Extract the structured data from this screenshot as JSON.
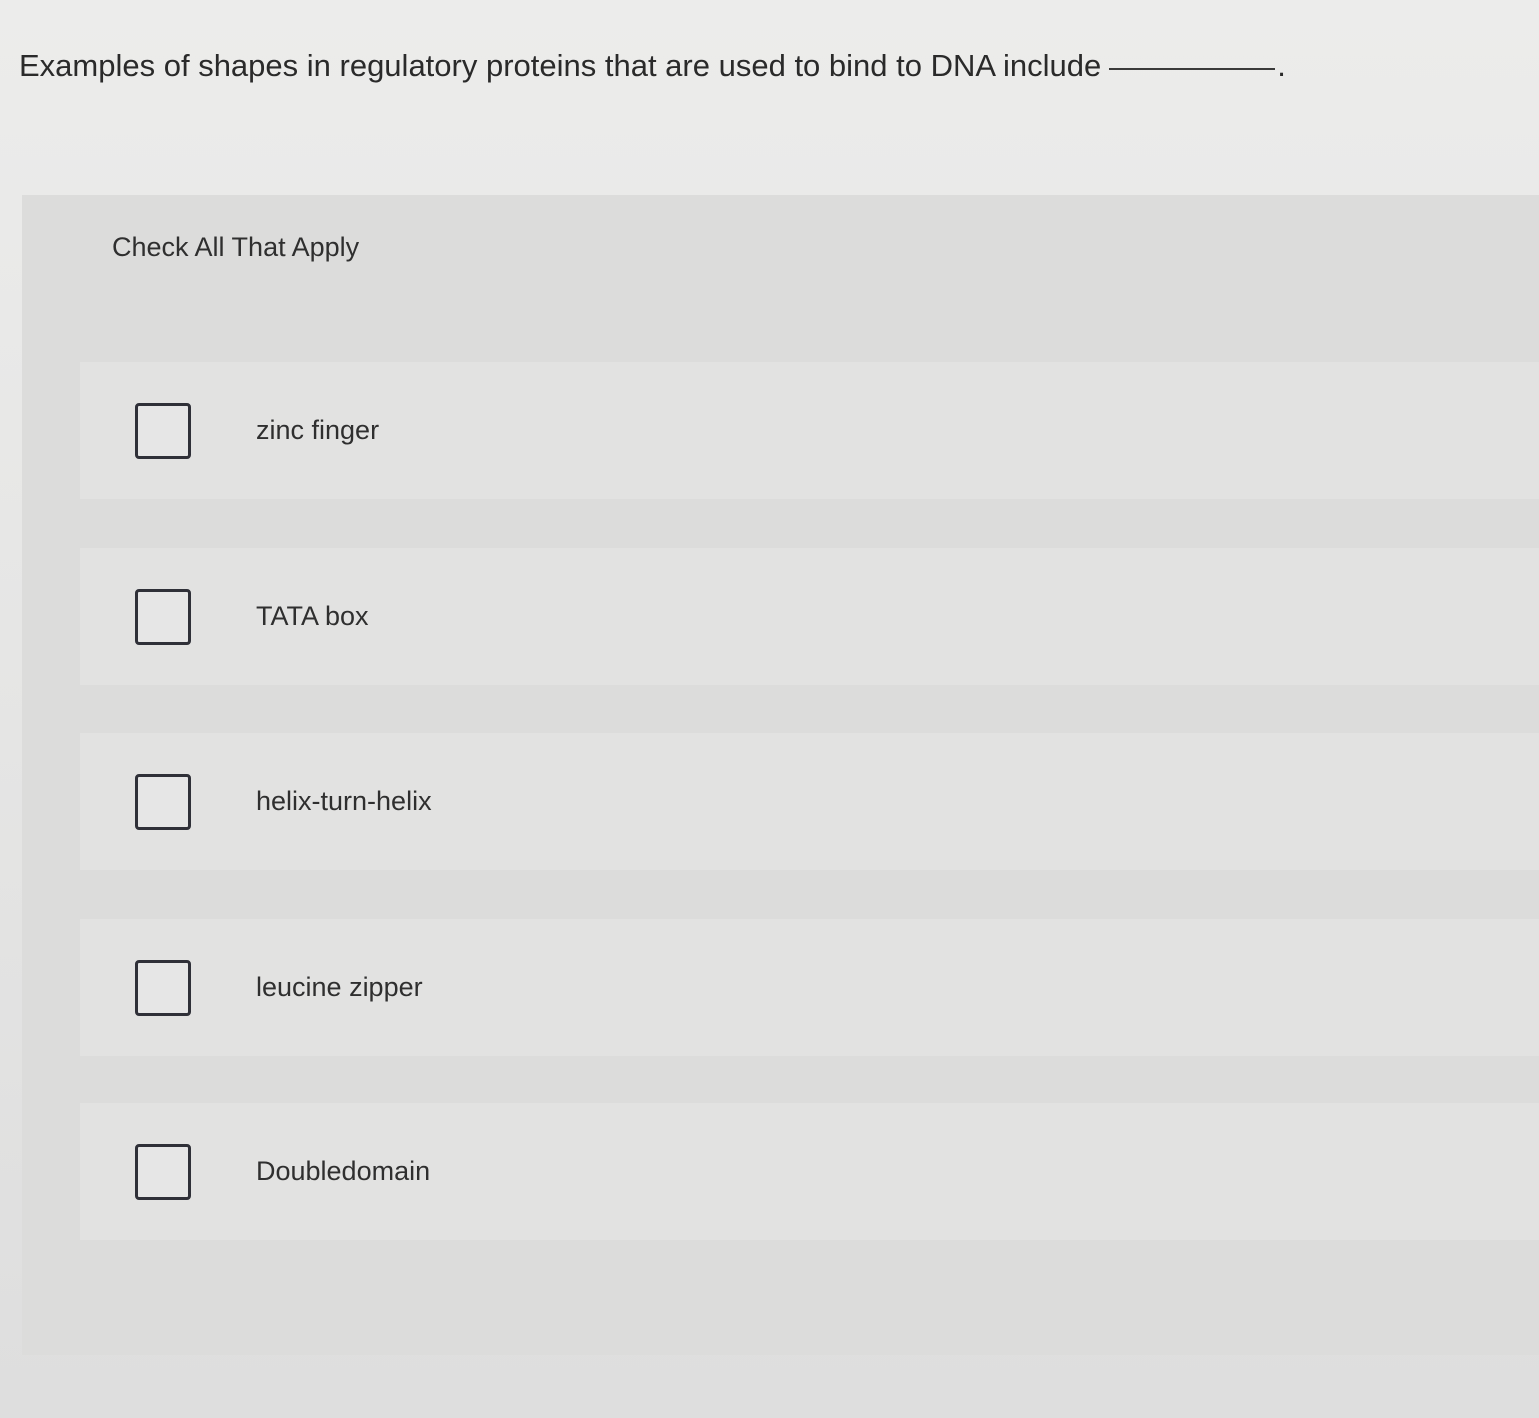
{
  "question": {
    "text": "Examples of shapes in regulatory proteins that are used to bind to DNA include",
    "period": "."
  },
  "panel": {
    "instruction": "Check All That Apply",
    "options": [
      {
        "label": "zinc finger",
        "checked": false
      },
      {
        "label": "TATA box",
        "checked": false
      },
      {
        "label": "helix-turn-helix",
        "checked": false
      },
      {
        "label": "leucine zipper",
        "checked": false
      },
      {
        "label": "Doubledomain",
        "checked": false
      }
    ]
  }
}
